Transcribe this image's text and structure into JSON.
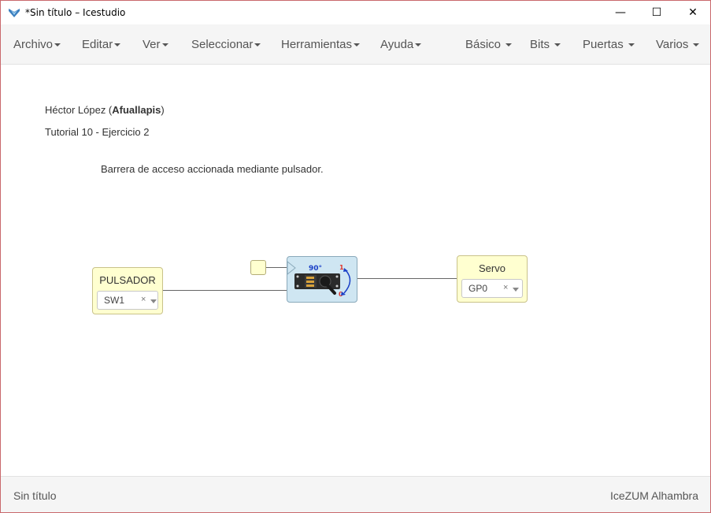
{
  "window": {
    "title": "*Sin título – Icestudio",
    "minimize_glyph": "—",
    "maximize_glyph": "☐",
    "close_glyph": "✕"
  },
  "menubar": {
    "left": [
      {
        "label": "Archivo"
      },
      {
        "label": "Editar"
      },
      {
        "label": "Ver"
      },
      {
        "label": "Seleccionar"
      },
      {
        "label": "Herramientas"
      },
      {
        "label": "Ayuda"
      }
    ],
    "right": [
      {
        "label": "Básico"
      },
      {
        "label": "Bits"
      },
      {
        "label": "Puertas"
      },
      {
        "label": "Varios"
      }
    ]
  },
  "canvas": {
    "author_name": "Héctor López (",
    "author_nick": "Afuallapis",
    "author_close": ")",
    "tutorial": "Tutorial 10 - Ejercicio 2",
    "description": "Barrera de acceso accionada mediante pulsador.",
    "pulsador": {
      "label": "PULSADOR",
      "value": "SW1",
      "clear": "×"
    },
    "servo_out": {
      "label": "Servo",
      "value": "GP0",
      "clear": "×"
    },
    "servo_block": {
      "angle_label": "90°",
      "mark_high": "1",
      "mark_low": "0"
    }
  },
  "statusbar": {
    "left": "Sin título",
    "right": "IceZUM Alhambra"
  },
  "colors": {
    "accent_red": "#e0342c",
    "accent_blue": "#1a3fc7",
    "block_yellow": "#ffffd0",
    "block_blue": "#cfe6f2"
  }
}
